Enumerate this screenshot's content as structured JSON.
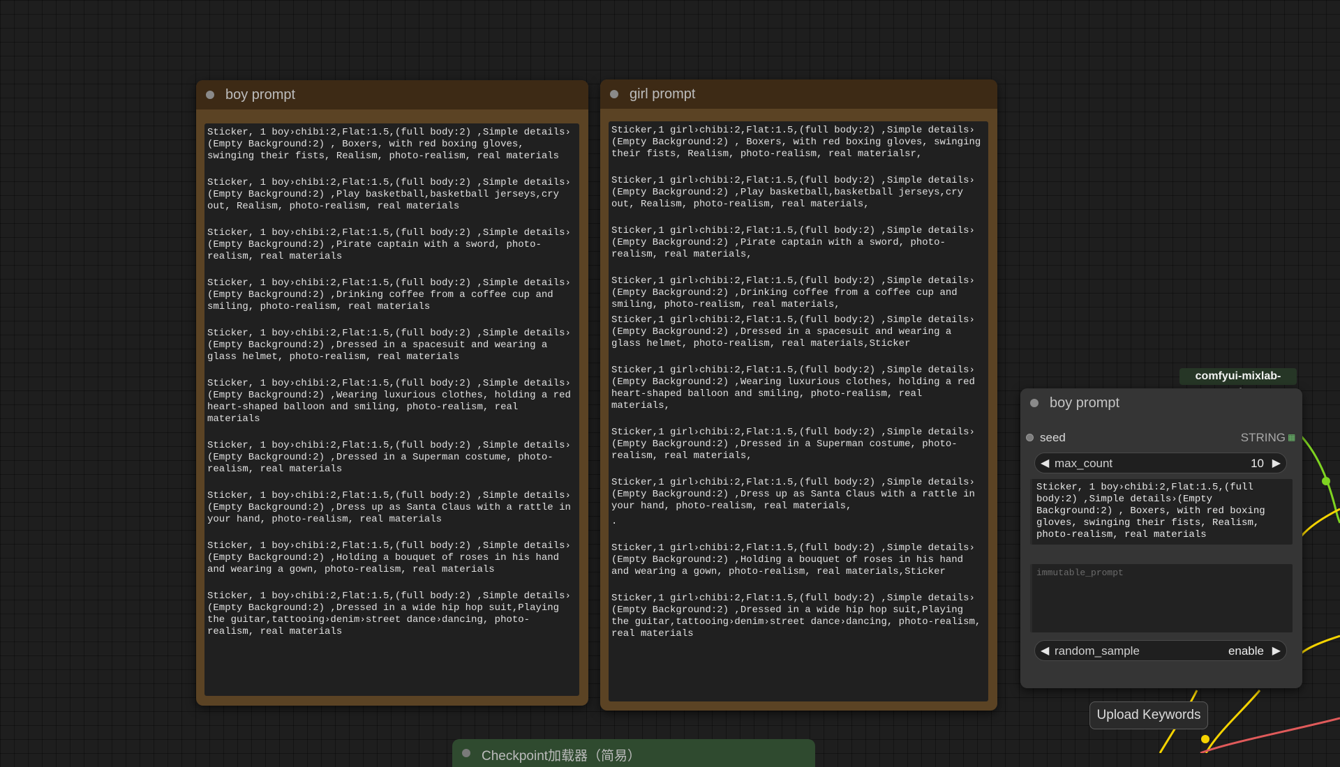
{
  "boy_node": {
    "title": "boy prompt",
    "paragraphs": [
      "Sticker, 1 boy›chibi:2,Flat:1.5,(full body:2) ,Simple details› (Empty Background:2) , Boxers, with red boxing gloves, swinging their fists, Realism, photo-realism, real materials",
      "Sticker, 1 boy›chibi:2,Flat:1.5,(full body:2) ,Simple details› (Empty Background:2) ,Play basketball,basketball jerseys,cry out, Realism, photo-realism, real materials",
      "Sticker, 1 boy›chibi:2,Flat:1.5,(full body:2) ,Simple details› (Empty Background:2) ,Pirate captain with a sword, photo-realism, real materials",
      "Sticker, 1 boy›chibi:2,Flat:1.5,(full body:2) ,Simple details› (Empty Background:2) ,Drinking coffee from a coffee cup and smiling, photo-realism, real materials",
      "Sticker, 1 boy›chibi:2,Flat:1.5,(full body:2) ,Simple details› (Empty Background:2) ,Dressed in a spacesuit and wearing a glass helmet, photo-realism, real materials",
      "Sticker, 1 boy›chibi:2,Flat:1.5,(full body:2) ,Simple details› (Empty Background:2) ,Wearing luxurious clothes, holding a red heart-shaped balloon and smiling, photo-realism, real materials",
      "Sticker, 1 boy›chibi:2,Flat:1.5,(full body:2) ,Simple details› (Empty Background:2) ,Dressed in a Superman costume, photo-realism, real materials",
      "Sticker, 1 boy›chibi:2,Flat:1.5,(full body:2) ,Simple details› (Empty Background:2) ,Dress up as Santa Claus with a rattle in your hand, photo-realism, real materials",
      "Sticker, 1 boy›chibi:2,Flat:1.5,(full body:2) ,Simple details› (Empty Background:2) ,Holding a bouquet of roses in his hand and wearing a gown, photo-realism, real materials",
      "Sticker, 1 boy›chibi:2,Flat:1.5,(full body:2) ,Simple details› (Empty Background:2) ,Dressed in a wide hip hop suit,Playing the guitar,tattooing›denim›street dance›dancing, photo-realism, real materials"
    ]
  },
  "girl_node": {
    "title": "girl prompt",
    "paragraphs": [
      "Sticker,1 girl›chibi:2,Flat:1.5,(full body:2) ,Simple details› (Empty Background:2) , Boxers, with red boxing gloves, swinging their fists, Realism, photo-realism, real materialsr,",
      "Sticker,1 girl›chibi:2,Flat:1.5,(full body:2) ,Simple details› (Empty Background:2) ,Play basketball,basketball jerseys,cry out, Realism, photo-realism, real materials,",
      "Sticker,1 girl›chibi:2,Flat:1.5,(full body:2) ,Simple details› (Empty Background:2) ,Pirate captain with a sword, photo-realism, real materials,",
      "Sticker,1 girl›chibi:2,Flat:1.5,(full body:2) ,Simple details› (Empty Background:2) ,Drinking coffee from a coffee cup and smiling, photo-realism, real materials,",
      "Sticker,1 girl›chibi:2,Flat:1.5,(full body:2) ,Simple details› (Empty Background:2) ,Dressed in a spacesuit and wearing a glass helmet, photo-realism, real materials,Sticker",
      "Sticker,1 girl›chibi:2,Flat:1.5,(full body:2) ,Simple details› (Empty Background:2) ,Wearing luxurious clothes, holding a red heart-shaped balloon and smiling, photo-realism, real materials,",
      "Sticker,1 girl›chibi:2,Flat:1.5,(full body:2) ,Simple details› (Empty Background:2) ,Dressed in a Superman costume, photo-realism, real materials,",
      "Sticker,1 girl›chibi:2,Flat:1.5,(full body:2) ,Simple details› (Empty Background:2) ,Dress up as Santa Claus with a rattle in your hand, photo-realism, real materials,",
      ".",
      "Sticker,1 girl›chibi:2,Flat:1.5,(full body:2) ,Simple details› (Empty Background:2) ,Holding a bouquet of roses in his hand and wearing a gown, photo-realism, real materials,Sticker",
      "Sticker,1 girl›chibi:2,Flat:1.5,(full body:2) ,Simple details› (Empty Background:2) ,Dressed in a wide hip hop suit,Playing the guitar,tattooing›denim›street dance›dancing, photo-realism, real materials"
    ]
  },
  "random_node": {
    "group_tag": "comfyui-mixlab-nodes",
    "title": "boy prompt",
    "seed_label": "seed",
    "seed_type": "STRING",
    "max_count_label": "max_count",
    "max_count_value": "10",
    "output_text": "Sticker, 1 boy›chibi:2,Flat:1.5,(full body:2) ,Simple details›(Empty Background:2) , Boxers, with red boxing gloves, swinging their fists, Realism, photo-realism, real materials",
    "immutable_placeholder": "immutable_prompt",
    "random_sample_label": "random_sample",
    "random_sample_value": "enable"
  },
  "upload_button": "Upload Keywords",
  "bottom_node_title": "Checkpoint加载器（简易）",
  "colors": {
    "canvas": "#1e1e1e",
    "node_body_brown": "#5b4324",
    "node_header_brown": "#3d2a15",
    "wire_green": "#7ed321",
    "wire_yellow": "#f5d300",
    "wire_red": "#e05a5a"
  }
}
